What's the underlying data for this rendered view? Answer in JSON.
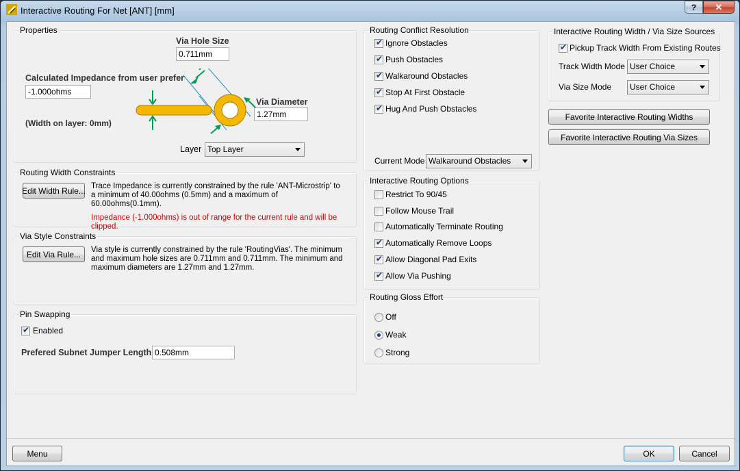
{
  "window": {
    "title": "Interactive Routing For Net [ANT] [mm]"
  },
  "properties": {
    "title": "Properties",
    "via_hole_label": "Via Hole Size",
    "via_hole_value": "0.711mm",
    "impedance_label": "Calculated Impedance from user preferred",
    "impedance_value": "-1.000ohms",
    "width_on_layer": "(Width on layer: 0mm)",
    "via_diameter_label": "Via Diameter",
    "via_diameter_value": "1.27mm",
    "layer_label": "Layer",
    "layer_value": "Top Layer",
    "diagram_colors": {
      "copper": "#f5b800",
      "copper_edge": "#b07800",
      "arrow": "#00a050",
      "guide": "#1a8fc0"
    }
  },
  "width_constraints": {
    "title": "Routing Width Constraints",
    "button": "Edit Width Rule...",
    "text": "Trace Impedance is currently constrained by the rule 'ANT-Microstrip' to a minimum of 40.00ohms (0.5mm) and a maximum of 60.00ohms(0.1mm).",
    "warning": "Impedance (-1.000ohms) is out of range for the current rule and will be clipped."
  },
  "via_constraints": {
    "title": "Via Style Constraints",
    "button": "Edit Via Rule...",
    "text": "Via style is currently constrained by the rule 'RoutingVias'. The minimum and maximum hole sizes are 0.711mm and 0.711mm. The minimum and maximum diameters are 1.27mm and 1.27mm."
  },
  "pin_swapping": {
    "title": "Pin Swapping",
    "enabled_label": "Enabled",
    "enabled": true,
    "jumper_label": "Prefered Subnet Jumper Length",
    "jumper_value": "0.508mm"
  },
  "conflict": {
    "title": "Routing Conflict Resolution",
    "items": [
      {
        "label": "Ignore Obstacles",
        "checked": true
      },
      {
        "label": "Push Obstacles",
        "checked": true
      },
      {
        "label": "Walkaround Obstacles",
        "checked": true
      },
      {
        "label": "Stop At First Obstacle",
        "checked": true
      },
      {
        "label": "Hug And Push Obstacles",
        "checked": true
      }
    ],
    "mode_label": "Current Mode",
    "mode_value": "Walkaround Obstacles"
  },
  "options": {
    "title": "Interactive Routing Options",
    "items": [
      {
        "label": "Restrict To 90/45",
        "checked": false
      },
      {
        "label": "Follow Mouse Trail",
        "checked": false
      },
      {
        "label": "Automatically Terminate Routing",
        "checked": false
      },
      {
        "label": "Automatically Remove Loops",
        "checked": true
      },
      {
        "label": "Allow Diagonal Pad Exits",
        "checked": true
      },
      {
        "label": "Allow Via Pushing",
        "checked": true
      }
    ]
  },
  "gloss": {
    "title": "Routing Gloss Effort",
    "items": [
      {
        "label": "Off",
        "checked": false
      },
      {
        "label": "Weak",
        "checked": true
      },
      {
        "label": "Strong",
        "checked": false
      }
    ]
  },
  "sources": {
    "title": "Interactive Routing Width / Via Size Sources",
    "pickup_label": "Pickup Track Width From Existing Routes",
    "pickup_checked": true,
    "track_mode_label": "Track Width Mode",
    "track_mode_value": "User Choice",
    "via_mode_label": "Via Size Mode",
    "via_mode_value": "User Choice",
    "fav_widths_button": "Favorite Interactive Routing Widths",
    "fav_vias_button": "Favorite Interactive Routing Via Sizes"
  },
  "footer": {
    "menu": "Menu",
    "ok": "OK",
    "cancel": "Cancel"
  }
}
